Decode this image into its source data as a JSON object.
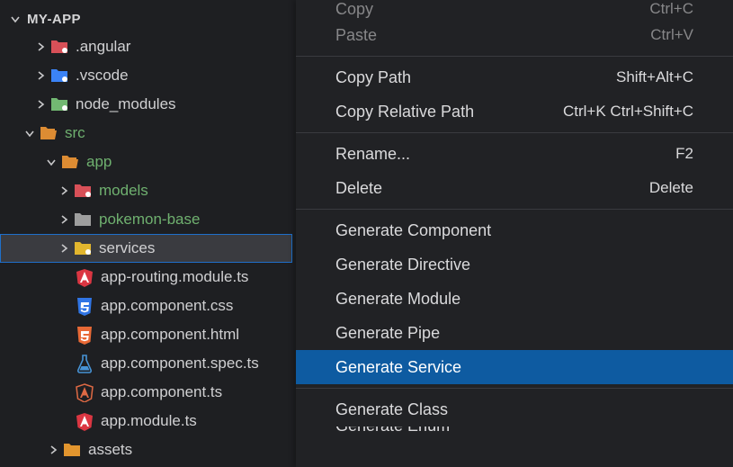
{
  "project": {
    "title": "MY-APP"
  },
  "tree": {
    "angular": ".angular",
    "vscode": ".vscode",
    "node_modules": "node_modules",
    "src": "src",
    "app": "app",
    "models": "models",
    "pokemon_base": "pokemon-base",
    "services": "services",
    "routing": "app-routing.module.ts",
    "css": "app.component.css",
    "html": "app.component.html",
    "spec": "app.component.spec.ts",
    "compts": "app.component.ts",
    "appmodule": "app.module.ts",
    "assets": "assets"
  },
  "ctx": {
    "copy": {
      "label": "Copy",
      "short": "Ctrl+C"
    },
    "paste": {
      "label": "Paste",
      "short": "Ctrl+V"
    },
    "copy_path": {
      "label": "Copy Path",
      "short": "Shift+Alt+C"
    },
    "copy_rel": {
      "label": "Copy Relative Path",
      "short": "Ctrl+K Ctrl+Shift+C"
    },
    "rename": {
      "label": "Rename...",
      "short": "F2"
    },
    "delete": {
      "label": "Delete",
      "short": "Delete"
    },
    "gen_component": "Generate Component",
    "gen_directive": "Generate Directive",
    "gen_module": "Generate Module",
    "gen_pipe": "Generate Pipe",
    "gen_service": "Generate Service",
    "gen_class": "Generate Class",
    "gen_enum": "Generate Enum"
  }
}
